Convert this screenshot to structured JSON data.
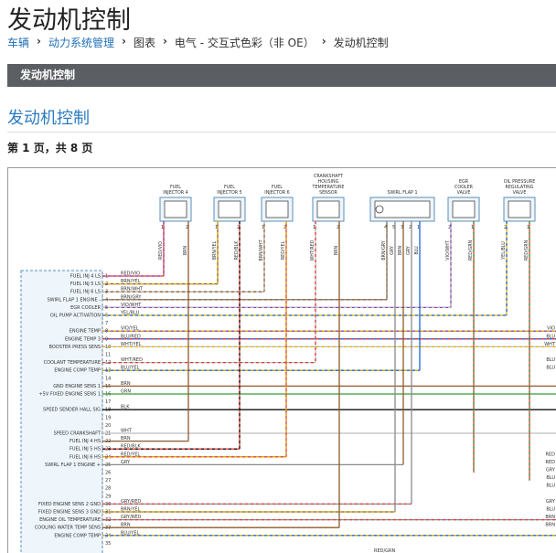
{
  "page": {
    "title": "发动机控制",
    "breadcrumb": [
      "车辆",
      "动力系统管理",
      "图表",
      "电气 - 交互式色彩（非 OE）",
      "发动机控制"
    ],
    "section_bar": "发动机控制",
    "heading": "发动机控制",
    "pager": "第 1 页，共 8 页"
  },
  "diagram": {
    "components": [
      {
        "name": "FUEL INJECTOR 4",
        "lines": [
          "FUEL",
          "INJECTOR 4"
        ],
        "pins": [
          "1",
          "2"
        ],
        "wires": [
          "RED/VIO",
          "BRN"
        ]
      },
      {
        "name": "FUEL INJECTOR 5",
        "lines": [
          "FUEL",
          "INJECTOR 5"
        ],
        "pins": [
          "1",
          "2"
        ],
        "wires": [
          "BRN/YEL",
          "RED/BLK"
        ]
      },
      {
        "name": "FUEL INJECTOR 6",
        "lines": [
          "FUEL",
          "INJECTOR 6"
        ],
        "pins": [
          "1",
          "2"
        ],
        "wires": [
          "BRN/WHT",
          "RED/YEL"
        ]
      },
      {
        "name": "CRANKSHAFT HOUSING TEMPERATURE SENSOR",
        "lines": [
          "CRANKSHAFT",
          "HOUSING",
          "TEMPERATURE",
          "SENSOR"
        ],
        "pins": [
          "1",
          "2"
        ],
        "wires": [
          "WHT/RED",
          "BRN"
        ]
      },
      {
        "name": "SWIRL FLAP 1",
        "lines": [
          "SWIRL FLAP 1"
        ],
        "pins": [
          "4",
          "5",
          "3",
          "2",
          "1"
        ],
        "wires": [
          "BRN/GRY",
          "GRY",
          "BRN",
          "GRY",
          "BLU"
        ]
      },
      {
        "name": "EGR COOLER VALVE",
        "lines": [
          "EGR",
          "COOLER",
          "VALVE"
        ],
        "pins": [
          "2",
          "1"
        ],
        "wires": [
          "VIO/WHT",
          "RED/GRN"
        ]
      },
      {
        "name": "OIL PRESSURE REGULATING VALVE",
        "lines": [
          "OIL PRESSURE",
          "REGULATING",
          "VALVE"
        ],
        "pins": [
          "2",
          "1"
        ],
        "wires": [
          "YEL/BLU",
          "RED/GRN"
        ]
      }
    ],
    "ecm_rows": [
      {
        "pin": "1",
        "func": "FUEL INJ 4 LS",
        "wire": "RED/VIO"
      },
      {
        "pin": "2",
        "func": "FUEL INJ 5 LS",
        "wire": "BRN/YEL"
      },
      {
        "pin": "3",
        "func": "FUEL INJ 6 LS",
        "wire": "BRN/WHT"
      },
      {
        "pin": "4",
        "func": "SWIRL FLAP 1 ENGINE -",
        "wire": "BRN/GRY"
      },
      {
        "pin": "5",
        "func": "EGR COOLER",
        "wire": "VIO/WHT"
      },
      {
        "pin": "6",
        "func": "OIL PUMP ACTIVATION",
        "wire": "YEL/BLU"
      },
      {
        "pin": "7",
        "func": "",
        "wire": ""
      },
      {
        "pin": "8",
        "func": "ENGINE TEMP",
        "wire": "VIO/YEL"
      },
      {
        "pin": "9",
        "func": "ENGINE TEMP 3",
        "wire": "BLU/RED"
      },
      {
        "pin": "10",
        "func": "BOOSTER PRESS SENS",
        "wire": "WHT/YEL"
      },
      {
        "pin": "11",
        "func": "",
        "wire": ""
      },
      {
        "pin": "12",
        "func": "COOLANT TEMPERATURE",
        "wire": "WHT/RED"
      },
      {
        "pin": "13",
        "func": "ENGINE COMP TEMP",
        "wire": "BLU/YEL"
      },
      {
        "pin": "14",
        "func": "",
        "wire": ""
      },
      {
        "pin": "15",
        "func": "GND ENGINE SENS 1",
        "wire": "BRN"
      },
      {
        "pin": "16",
        "func": "+5V FIXED ENGINE SENS 1",
        "wire": "GRN"
      },
      {
        "pin": "17",
        "func": "",
        "wire": ""
      },
      {
        "pin": "18",
        "func": "SPEED SENDER HALL SIG",
        "wire": "BLK"
      },
      {
        "pin": "19",
        "func": "",
        "wire": ""
      },
      {
        "pin": "20",
        "func": "",
        "wire": ""
      },
      {
        "pin": "21",
        "func": "SPEED CRANKSHAFT",
        "wire": "WHT"
      },
      {
        "pin": "22",
        "func": "FUEL INJ 4 HS",
        "wire": "BRN"
      },
      {
        "pin": "23",
        "func": "FUEL INJ 5 HS",
        "wire": "RED/BLK"
      },
      {
        "pin": "24",
        "func": "FUEL INJ 6 HS",
        "wire": "RED/YEL"
      },
      {
        "pin": "25",
        "func": "SWIRL FLAP 1 ENGINE +",
        "wire": "GRY"
      },
      {
        "pin": "26",
        "func": "",
        "wire": ""
      },
      {
        "pin": "27",
        "func": "",
        "wire": ""
      },
      {
        "pin": "28",
        "func": "",
        "wire": ""
      },
      {
        "pin": "29",
        "func": "",
        "wire": ""
      },
      {
        "pin": "30",
        "func": "FIXED ENGINE SENS 2 GND",
        "wire": "GRY/RED"
      },
      {
        "pin": "31",
        "func": "FIXED ENGINE SENS 3 GND",
        "wire": "BRN/YEL"
      },
      {
        "pin": "32",
        "func": "ENGINE OIL TEMPERATURE",
        "wire": "GRY/RED"
      },
      {
        "pin": "33",
        "func": "COOLING WATER TEMP SENS",
        "wire": "BRN"
      },
      {
        "pin": "34",
        "func": "ENGINE COMP TEMP",
        "wire": "BLU/YEL"
      },
      {
        "pin": "35",
        "func": "",
        "wire": ""
      }
    ],
    "right_edge_labels": [
      {
        "row": 8,
        "text": "VIO"
      },
      {
        "row": 9,
        "text": "BLU"
      },
      {
        "row": 10,
        "text": "WHT"
      },
      {
        "row": 12,
        "text": "BLU"
      },
      {
        "row": 13,
        "text": "BLU"
      },
      {
        "row": 24,
        "text": "RED"
      },
      {
        "row": 25,
        "text": "RED"
      },
      {
        "row": 26,
        "text": "GRY"
      },
      {
        "row": 27,
        "text": "BLU"
      },
      {
        "row": 28,
        "text": "BLU"
      },
      {
        "row": 30,
        "text": "GRY"
      },
      {
        "row": 31,
        "text": "BLU"
      },
      {
        "row": 32,
        "text": "BRN"
      },
      {
        "row": 33,
        "text": "BRN"
      }
    ],
    "bottom_label": "RED/GRN",
    "colors": {
      "RED": "#e53935",
      "BRN": "#8d5a2b",
      "YEL": "#d9b500",
      "WHT": "#bdbdbd",
      "VIO": "#8e44ad",
      "GRY": "#8a8a8a",
      "BLU": "#1e63d6",
      "GRN": "#2e9e3a",
      "BLK": "#111111",
      "frame": "#5a8fb8"
    }
  }
}
